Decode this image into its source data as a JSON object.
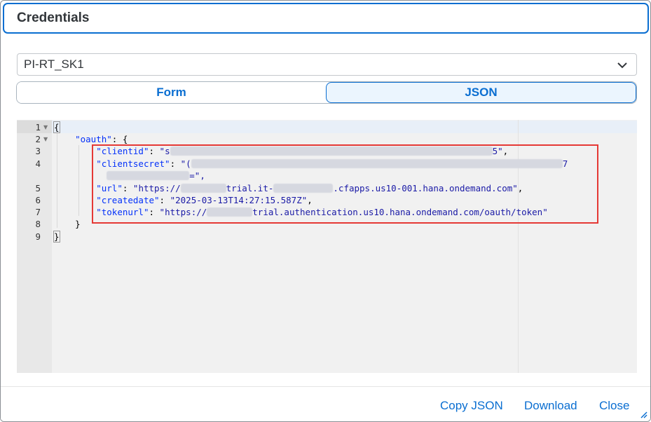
{
  "dialog": {
    "title": "Credentials"
  },
  "select": {
    "value": "PI-RT_SK1"
  },
  "segments": {
    "form": "Form",
    "json": "JSON",
    "active": "json"
  },
  "editor": {
    "line_numbers": [
      "1",
      "2",
      "3",
      "4",
      "",
      "5",
      "6",
      "7",
      "8",
      "9"
    ],
    "lines": {
      "l1": "{",
      "l2_key": "\"oauth\"",
      "l2_rest": ": {",
      "l3_key": "\"clientid\"",
      "l3_a": "\"s",
      "l3_b": "5\"",
      "l4_key": "\"clientsecret\"",
      "l4_a": "\"(",
      "l4_b": "7",
      "l4c_end": "=\",",
      "l5_key": "\"url\"",
      "l5_a": "\"https://",
      "l5_b": "trial.it-",
      "l5_c": ".cfapps.us10-001.hana.ondemand.com\"",
      "l6_key": "\"createdate\"",
      "l6_val": "\"2025-03-13T14:27:15.587Z\"",
      "l7_key": "\"tokenurl\"",
      "l7_a": "\"https://",
      "l7_b": "trial.authentication.us10.hana.ondemand.com/oauth/token\"",
      "l8": "}",
      "l9": "}"
    }
  },
  "footer": {
    "copy_json": "Copy JSON",
    "download": "Download",
    "close": "Close"
  },
  "colors": {
    "accent": "#0a6ed1",
    "highlight": "#e53935"
  }
}
